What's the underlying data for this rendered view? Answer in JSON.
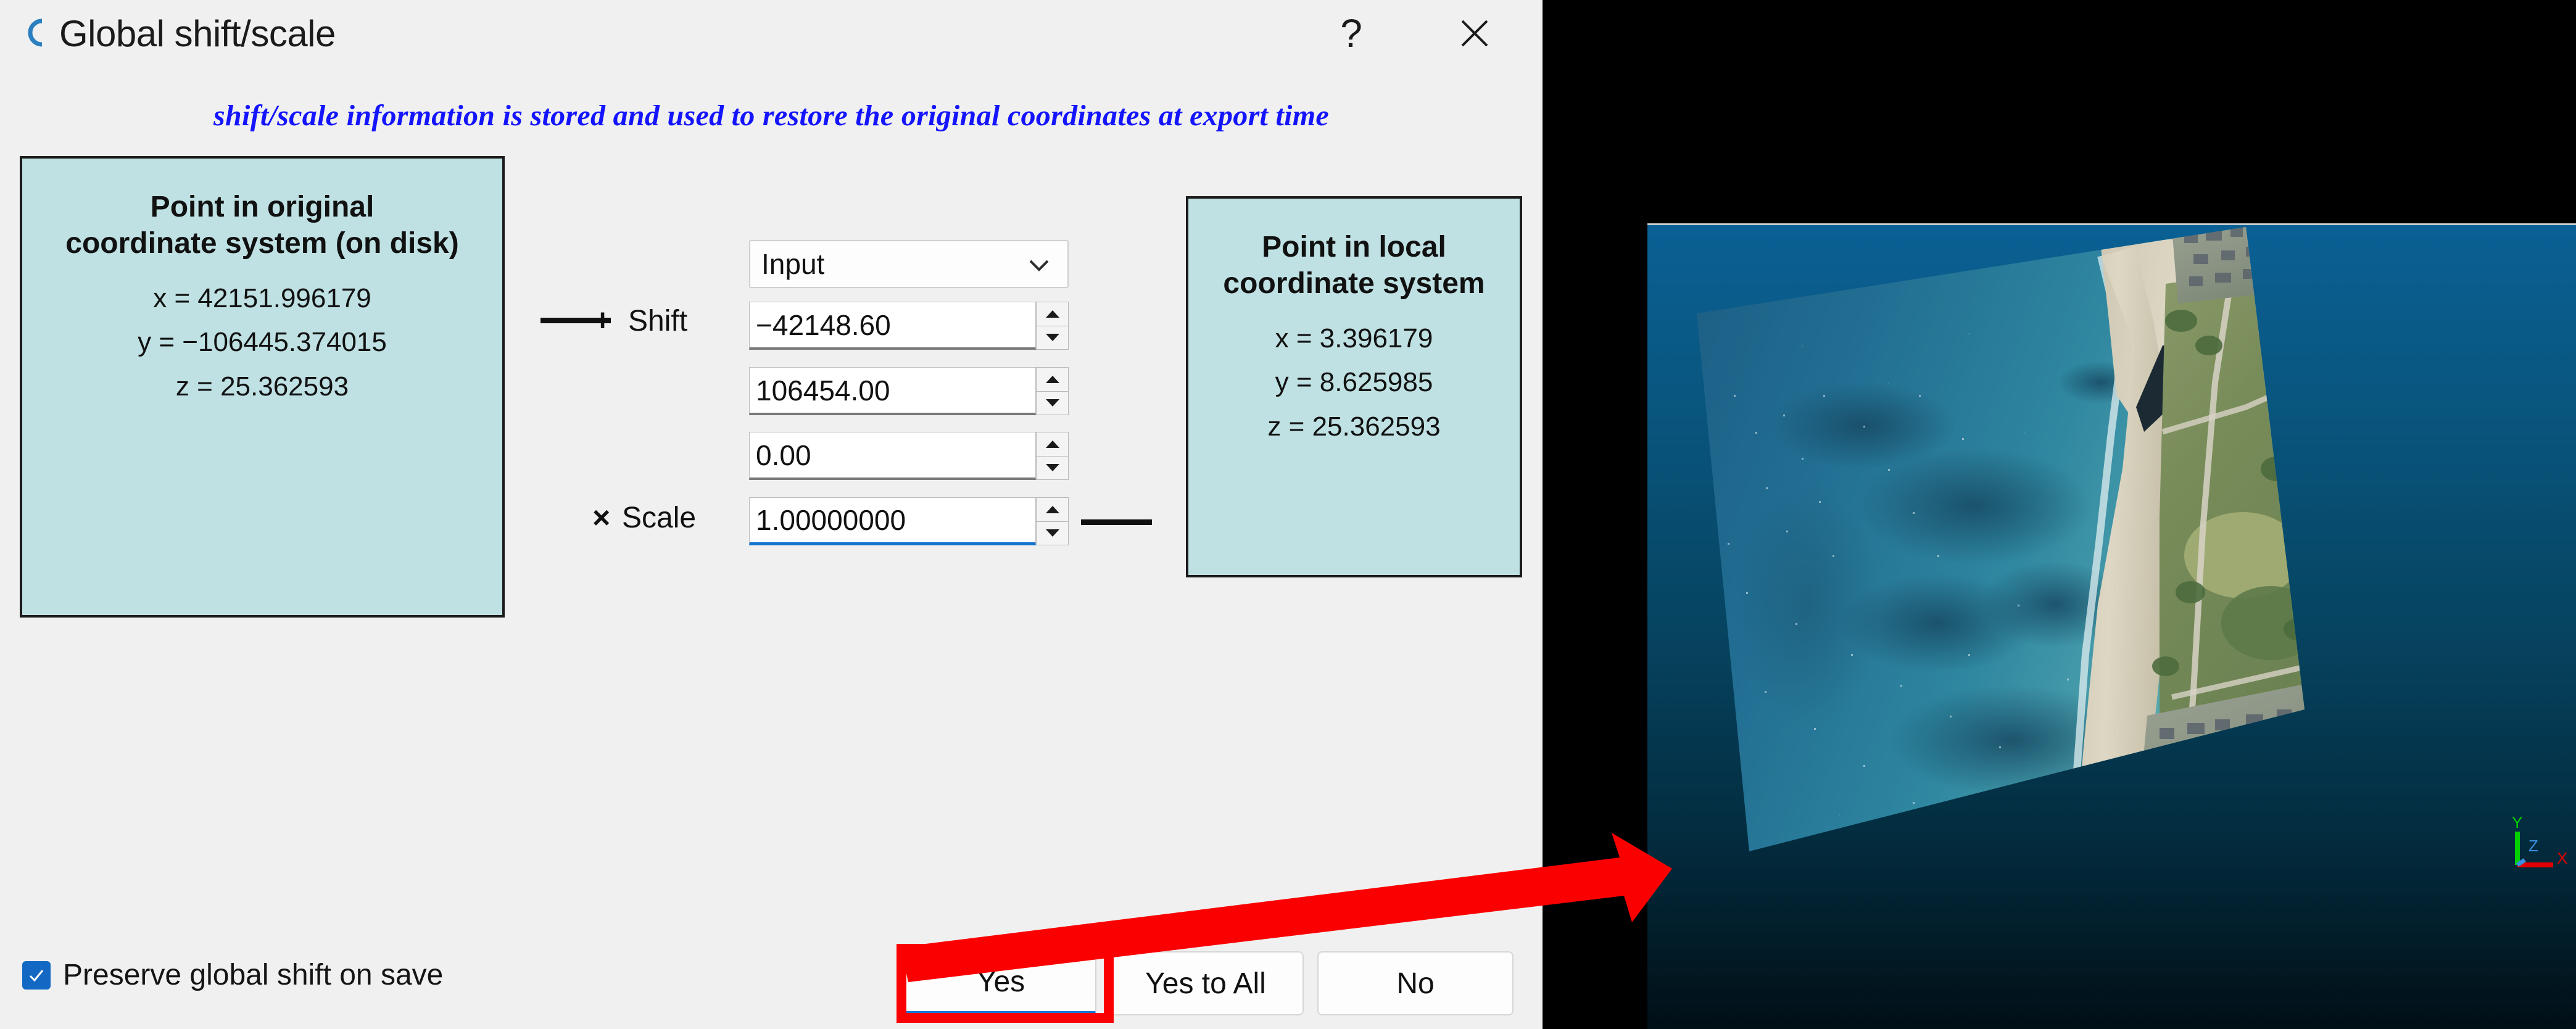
{
  "window": {
    "title": "Global shift/scale",
    "logo_icon": "cloudcompare-logo-icon",
    "help_icon": "?",
    "close_icon": "close-icon"
  },
  "hint": {
    "text": "shift/scale information is stored and used to restore the original coordinates at export time",
    "color": "#1414ff"
  },
  "original_panel": {
    "title": "Point in original\ncoordinate system (on disk)",
    "coords": [
      "x = 42151.996179",
      "y = −106445.374015",
      "z = 25.362593"
    ],
    "background": "#bfe1e3"
  },
  "local_panel": {
    "title": "Point in local\ncoordinate system",
    "coords": [
      "x = 3.396179",
      "y = 8.625985",
      "z = 25.362593"
    ],
    "background": "#bfe1e3"
  },
  "controls": {
    "preset_combo": {
      "selected": "Input",
      "chevron_icon": "chevron-down-icon"
    },
    "shift_label": "Shift",
    "shift_sign": "+",
    "scale_label": "Scale",
    "scale_sign": "×",
    "shift_x": "−42148.60",
    "shift_y": "106454.00",
    "shift_z": "0.00",
    "scale": "1.00000000",
    "spin_up_icon": "spin-up-icon",
    "spin_down_icon": "spin-down-icon"
  },
  "footer": {
    "preserve_checkbox": {
      "label": "Preserve global shift on save",
      "checked": true,
      "check_icon": "check-icon",
      "color": "#1268c3"
    },
    "buttons": {
      "yes": "Yes",
      "yes_to_all": "Yes to All",
      "no": "No"
    },
    "default_button_accent": "#1675d1"
  },
  "annotation": {
    "highlight_target": "Yes",
    "color": "#fb0000",
    "arrow_icon": "arrow-right-icon"
  },
  "viewport": {
    "background": "#000000",
    "scene": "aerial point cloud of a coastal beach, shallow water and town",
    "axis_gizmo": {
      "x_label": "X",
      "y_label": "Y",
      "z_label": "Z",
      "x_color": "#e00000",
      "y_color": "#00d000",
      "z_color": "#3a8fe0"
    }
  }
}
